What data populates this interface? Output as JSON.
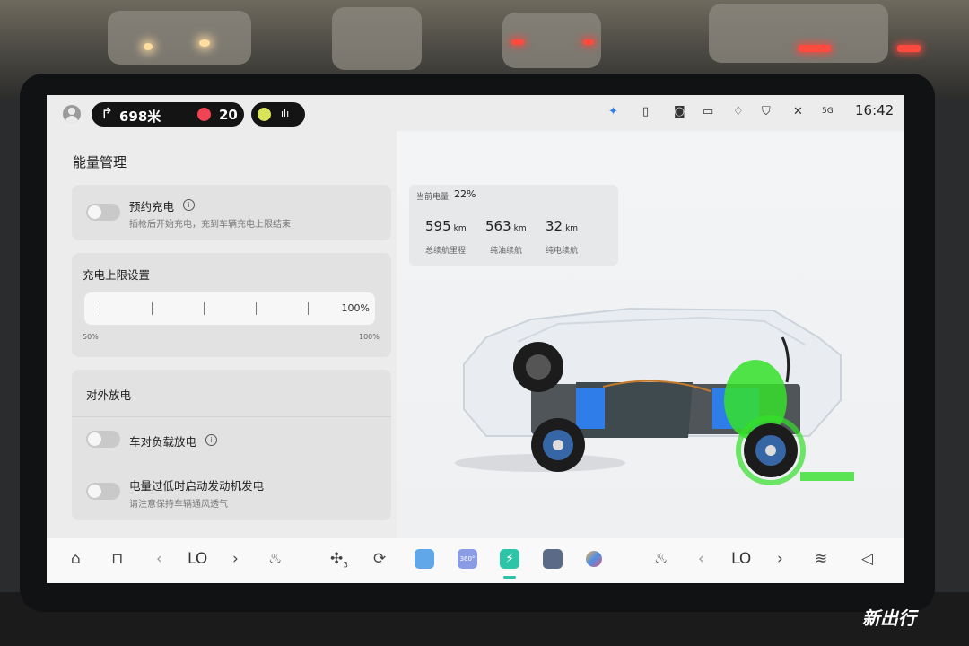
{
  "status": {
    "nav_distance": "698米",
    "record_count": "20",
    "media_bars": "ılı",
    "time": "16:42",
    "icons": [
      "user-avatar",
      "turn-arrow",
      "record-dot",
      "media-icon",
      "bluetooth-icon",
      "phone-icon",
      "wifi-icon",
      "camera-icon",
      "bell-icon",
      "shield-icon",
      "mute-icon",
      "5g-icon"
    ],
    "network_label": "5G"
  },
  "page": {
    "title": "能量管理"
  },
  "scheduled_charge": {
    "label": "预约充电",
    "desc": "插枪后开始充电，充到车辆充电上限结束",
    "enabled": false
  },
  "charge_limit": {
    "label": "充电上限设置",
    "value": "100%",
    "min_label": "50%",
    "max_label": "100%"
  },
  "external_discharge": {
    "label": "对外放电",
    "v2l": {
      "label": "车对负载放电",
      "enabled": false
    },
    "low_battery": {
      "label": "电量过低时启动发动机发电",
      "desc": "请注意保持车辆通风透气",
      "enabled": false
    }
  },
  "energy": {
    "current_label": "当前电量",
    "current_value": "22%",
    "stats": [
      {
        "value": "595",
        "unit": "km",
        "caption": "总续航里程"
      },
      {
        "value": "563",
        "unit": "km",
        "caption": "纯油续航"
      },
      {
        "value": "32",
        "unit": "km",
        "caption": "纯电续航"
      }
    ]
  },
  "dock": {
    "left_temp": "LO",
    "right_temp": "LO",
    "fan_level": "3",
    "prev": "‹",
    "next": "›",
    "app_360_label": "360°"
  },
  "colors": {
    "accent": "#2ec4a8",
    "battery": "#2f7de8",
    "wheel_glow": "#35e02a",
    "record": "#f04454"
  },
  "watermark": "新出行"
}
